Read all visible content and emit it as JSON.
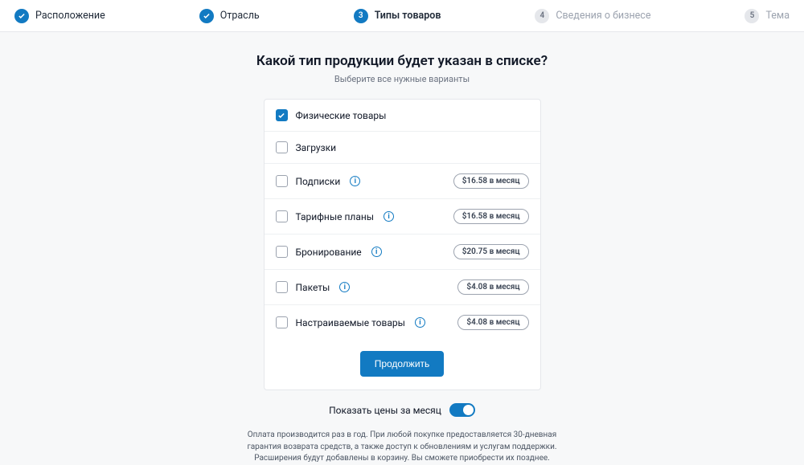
{
  "stepper": {
    "steps": [
      {
        "label": "Расположение",
        "state": "done"
      },
      {
        "label": "Отрасль",
        "state": "done"
      },
      {
        "label": "Типы товаров",
        "state": "active",
        "num": "3"
      },
      {
        "label": "Сведения о бизнесе",
        "state": "pending",
        "num": "4"
      },
      {
        "label": "Тема",
        "state": "pending",
        "num": "5"
      }
    ]
  },
  "title": "Какой тип продукции будет указан в списке?",
  "subtitle": "Выберите все нужные варианты",
  "options": [
    {
      "label": "Физические товары",
      "checked": true,
      "info": false,
      "price": null
    },
    {
      "label": "Загрузки",
      "checked": false,
      "info": false,
      "price": null
    },
    {
      "label": "Подписки",
      "checked": false,
      "info": true,
      "price": "$16.58 в месяц"
    },
    {
      "label": "Тарифные планы",
      "checked": false,
      "info": true,
      "price": "$16.58 в месяц"
    },
    {
      "label": "Бронирование",
      "checked": false,
      "info": true,
      "price": "$20.75 в месяц"
    },
    {
      "label": "Пакеты",
      "checked": false,
      "info": true,
      "price": "$4.08 в месяц"
    },
    {
      "label": "Настраиваемые товары",
      "checked": false,
      "info": true,
      "price": "$4.08 в месяц"
    }
  ],
  "continue_label": "Продолжить",
  "toggle_label": "Показать цены за месяц",
  "fine_print": "Оплата производится раз в год. При любой покупке предоставляется 30-дневная гарантия возврата средств, а также доступ к обновлениям и услугам поддержки. Расширения будут добавлены в корзину. Вы сможете приобрести их позднее."
}
